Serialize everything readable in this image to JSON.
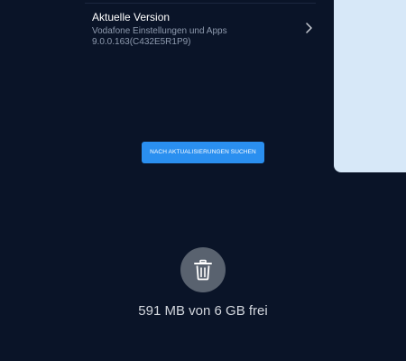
{
  "version": {
    "title": "Aktuelle Version",
    "app_name": "Vodafone Einstellungen und Apps",
    "number": "9.0.0.163(C432E5R1P9)"
  },
  "update_button": {
    "label": "NACH AKTUALISIERUNGEN SUCHEN"
  },
  "storage": {
    "text": "591 MB von 6 GB frei"
  },
  "icons": {
    "chevron": "chevron-right-icon",
    "trash": "trash-icon"
  },
  "colors": {
    "background": "#0a1428",
    "accent": "#2a8ff0",
    "side_panel": "#d7e8f8",
    "icon_circle": "#59626f"
  }
}
